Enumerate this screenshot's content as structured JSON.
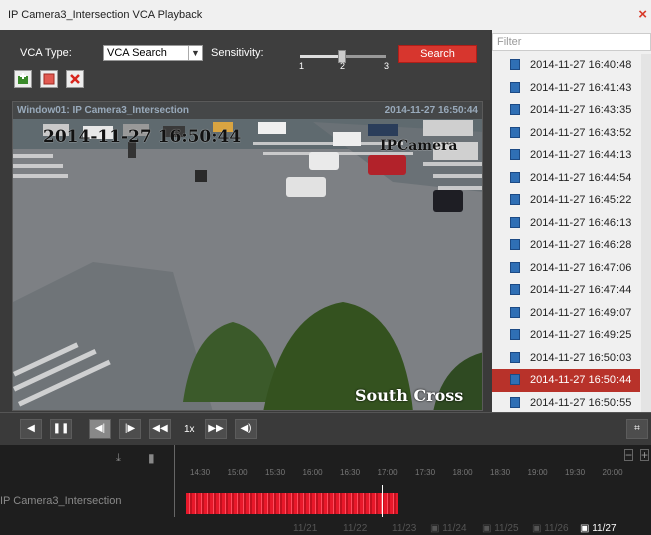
{
  "window": {
    "title": "IP Camera3_Intersection VCA Playback",
    "close_icon": "close-icon"
  },
  "toolbar": {
    "vca_type_label": "VCA Type:",
    "vca_type_value": "VCA Search",
    "sensitivity_label": "Sensitivity:",
    "sensitivity_ticks": [
      "1",
      "2",
      "3"
    ],
    "sensitivity_value": 2,
    "search_label": "Search",
    "icons": [
      "add-rule-icon",
      "stop-icon",
      "delete-icon"
    ]
  },
  "video": {
    "window_label": "Window01: IP Camera3_Intersection",
    "header_time": "2014-11-27 16:50:44",
    "osd_time": "2014-11-27 16:50:44",
    "osd_camera": "IPCamera",
    "osd_location": "South Cross"
  },
  "results": {
    "filter_placeholder": "Filter",
    "items": [
      "2014-11-27 16:40:48",
      "2014-11-27 16:41:43",
      "2014-11-27 16:43:35",
      "2014-11-27 16:43:52",
      "2014-11-27 16:44:13",
      "2014-11-27 16:44:54",
      "2014-11-27 16:45:22",
      "2014-11-27 16:46:13",
      "2014-11-27 16:46:28",
      "2014-11-27 16:47:06",
      "2014-11-27 16:47:44",
      "2014-11-27 16:49:07",
      "2014-11-27 16:49:25",
      "2014-11-27 16:50:03",
      "2014-11-27 16:50:44",
      "2014-11-27 16:50:55"
    ],
    "selected_index": 14
  },
  "playback": {
    "speed": "1x"
  },
  "timeline": {
    "camera": "IP Camera3_Intersection",
    "ticks": [
      "14:30",
      "15:00",
      "15:30",
      "16:00",
      "16:30",
      "17:00",
      "17:30",
      "18:00",
      "18:30",
      "19:00",
      "19:30",
      "20:00"
    ],
    "dates": [
      "11/21",
      "11/22",
      "11/23",
      "11/24",
      "11/25",
      "11/26",
      "11/27"
    ],
    "active_date": "11/27"
  },
  "colors": {
    "accent": "#d7362e",
    "selection": "#b8322a",
    "record": "#e8182a"
  }
}
